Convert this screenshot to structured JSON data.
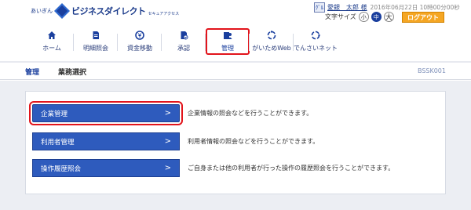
{
  "header": {
    "logo_small": "あいぎん",
    "logo_name": "ビジネスダイレクト",
    "logo_sub": "セキュアアクセス",
    "user_icon": "ｸﾞﾙ",
    "user_name": "愛銀　太郎 様",
    "login_time": "2016年06月22日 10時00分00秒",
    "font_size_label": "文字サイズ",
    "font_sizes": [
      "小",
      "中",
      "大"
    ],
    "logout_label": "ログアウト"
  },
  "nav": {
    "items": [
      {
        "label": "ホーム",
        "icon": "home-icon"
      },
      {
        "label": "明細照会",
        "icon": "document-icon"
      },
      {
        "label": "資金移動",
        "icon": "yen-icon"
      },
      {
        "label": "承認",
        "icon": "approval-icon"
      },
      {
        "label": "管理",
        "icon": "management-icon"
      },
      {
        "label": "がいためWeb",
        "icon": "globe-icon"
      },
      {
        "label": "でんさいネット",
        "icon": "network-icon"
      }
    ]
  },
  "titlebar": {
    "main": "管理",
    "sub": "業務選択",
    "code": "BSSK001"
  },
  "menu": {
    "items": [
      {
        "label": "企業管理",
        "chevron": ">",
        "description": "企業情報の照会などを行うことができます。"
      },
      {
        "label": "利用者管理",
        "chevron": ">",
        "description": "利用者情報の照会などを行うことができます。"
      },
      {
        "label": "操作履歴照会",
        "chevron": ">",
        "description": "ご自身または他の利用者が行った操作の履歴照会を行うことができます。"
      }
    ]
  },
  "colors": {
    "brand": "#1a3f9e",
    "button": "#2e5bbd",
    "highlight": "#e2141b",
    "logout": "#f5a623"
  }
}
